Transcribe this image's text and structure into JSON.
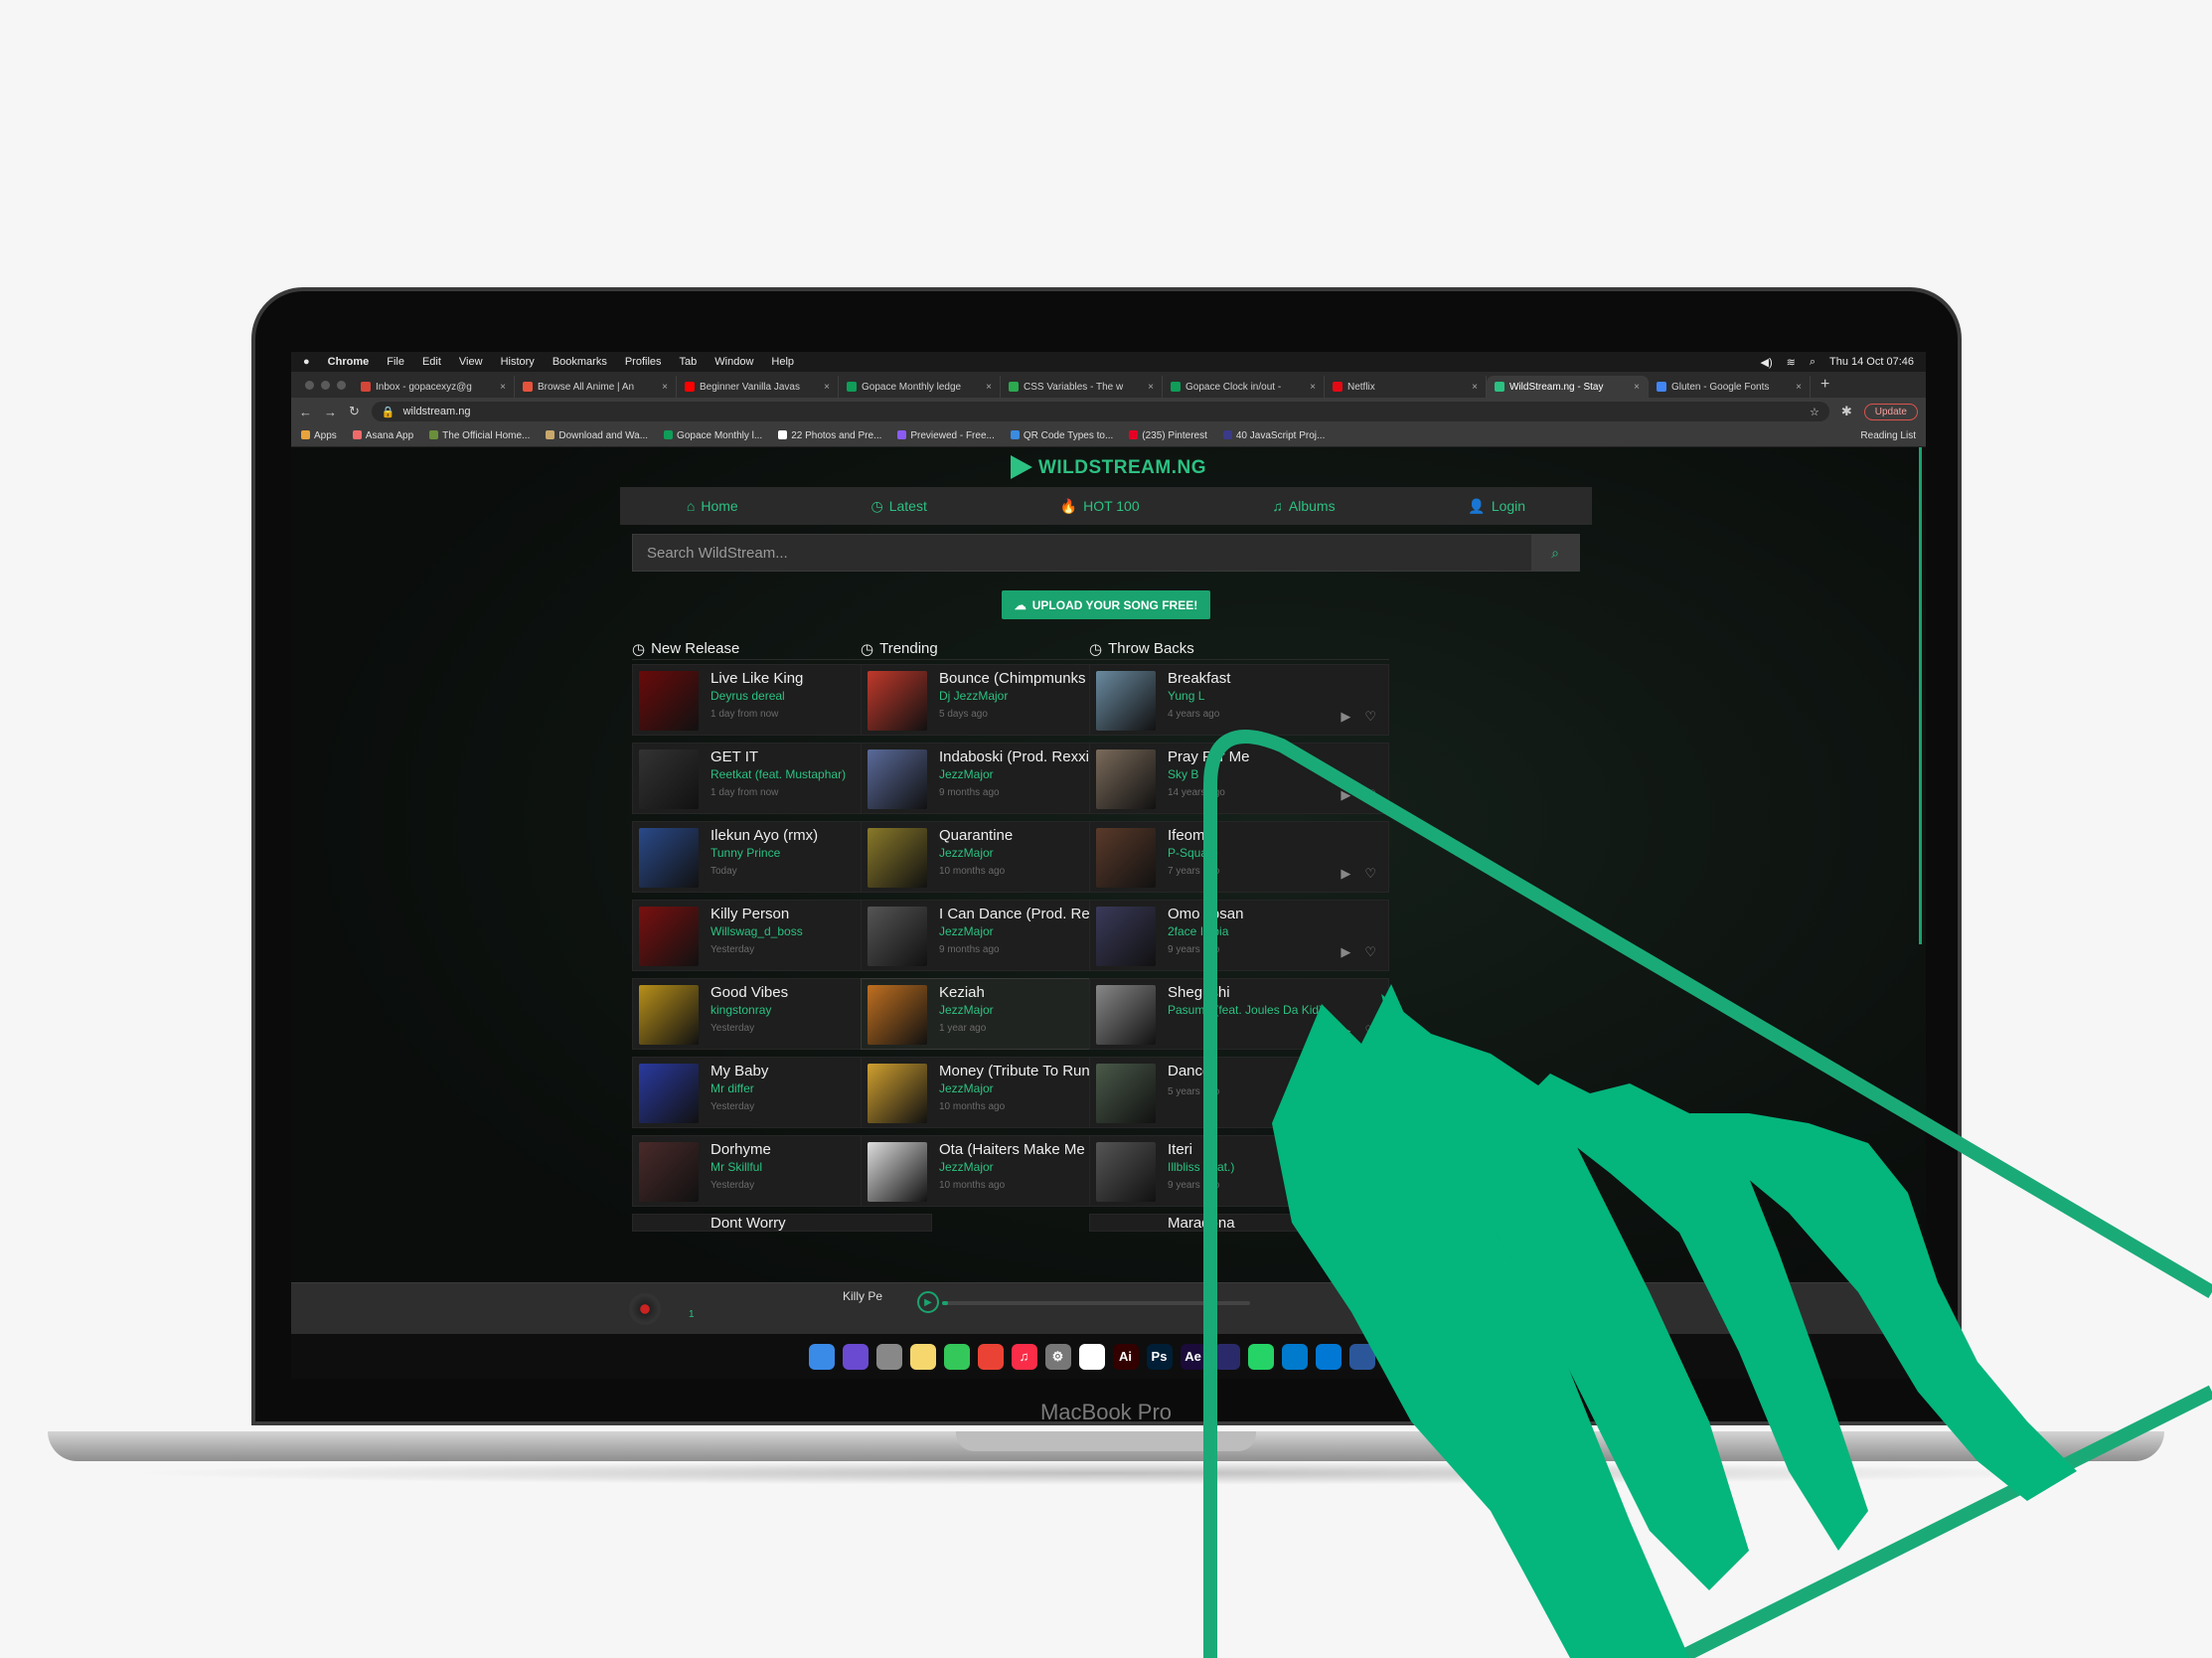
{
  "device": {
    "label": "MacBook Pro"
  },
  "menubar": {
    "app": "Chrome",
    "items": [
      "File",
      "Edit",
      "View",
      "History",
      "Bookmarks",
      "Profiles",
      "Tab",
      "Window",
      "Help"
    ],
    "datetime": "Thu 14 Oct  07:46"
  },
  "tabs": [
    {
      "title": "Inbox - gopacexyz@g",
      "color": "#d44638"
    },
    {
      "title": "Browse All Anime | An",
      "color": "#e5533c"
    },
    {
      "title": "Beginner Vanilla Javas",
      "color": "#ff0000"
    },
    {
      "title": "Gopace Monthly ledge",
      "color": "#0f9d58"
    },
    {
      "title": "CSS Variables - The w",
      "color": "#2ba94f"
    },
    {
      "title": "Gopace Clock in/out -",
      "color": "#0f9d58"
    },
    {
      "title": "Netflix",
      "color": "#e50914"
    },
    {
      "title": "WildStream.ng - Stay",
      "color": "#2cc182",
      "active": true
    },
    {
      "title": "Gluten - Google Fonts",
      "color": "#4285f4"
    }
  ],
  "address": {
    "url": "wildstream.ng",
    "update_label": "Update"
  },
  "bookmarks": [
    {
      "label": "Apps",
      "color": "#e8a33d"
    },
    {
      "label": "Asana App",
      "color": "#f06a6a"
    },
    {
      "label": "The Official Home...",
      "color": "#6a8f3a"
    },
    {
      "label": "Download and Wa...",
      "color": "#c9a86b"
    },
    {
      "label": "Gopace Monthly l...",
      "color": "#0f9d58"
    },
    {
      "label": "22 Photos and Pre...",
      "color": "#ffffff"
    },
    {
      "label": "Previewed - Free...",
      "color": "#8a5cf5"
    },
    {
      "label": "QR Code Types to...",
      "color": "#3b8be0"
    },
    {
      "label": "(235) Pinterest",
      "color": "#e60023"
    },
    {
      "label": "40 JavaScript Proj...",
      "color": "#3a3a8a"
    }
  ],
  "bookmarks_reading_list": "Reading List",
  "site": {
    "logo": "WILDSTREAM.NG",
    "nav": [
      {
        "label": "Home",
        "icon": "home-icon",
        "glyph": "⌂"
      },
      {
        "label": "Latest",
        "icon": "clock-icon",
        "glyph": "◷"
      },
      {
        "label": "HOT 100",
        "icon": "fire-icon",
        "glyph": "🔥"
      },
      {
        "label": "Albums",
        "icon": "headphones-icon",
        "glyph": "♫"
      },
      {
        "label": "Login",
        "icon": "user-icon",
        "glyph": "👤"
      }
    ],
    "search_placeholder": "Search WildStream...",
    "upload_label": "UPLOAD YOUR SONG FREE!",
    "columns": [
      {
        "title": "New Release",
        "icon": "clock-icon",
        "songs": [
          {
            "title": "Live Like King",
            "artist": "Deyrus dereal",
            "date": "1 day from now",
            "color": "#6a0a0a"
          },
          {
            "title": "GET IT",
            "artist": "Reetkat (feat. Mustaphar)",
            "date": "1 day from now",
            "color": "#333"
          },
          {
            "title": "Ilekun Ayo (rmx)",
            "artist": "Tunny Prince",
            "date": "Today",
            "color": "#2a4a8a"
          },
          {
            "title": "Killy Person",
            "artist": "Willswag_d_boss",
            "date": "Yesterday",
            "color": "#7a1010"
          },
          {
            "title": "Good Vibes",
            "artist": "kingstonray",
            "date": "Yesterday",
            "color": "#b8901a"
          },
          {
            "title": "My Baby",
            "artist": "Mr differ",
            "date": "Yesterday",
            "color": "#2a3aa0"
          },
          {
            "title": "Dorhyme",
            "artist": "Mr Skillful",
            "date": "Yesterday",
            "color": "#4a2a2a"
          }
        ],
        "partial": "Dont Worry"
      },
      {
        "title": "Trending",
        "icon": "chart-icon",
        "songs": [
          {
            "title": "Bounce (Chimpmunks Remix)",
            "artist": "Dj JezzMajor",
            "date": "5 days ago",
            "color": "#c0392b"
          },
          {
            "title": "Indaboski (Prod. Rexxie)",
            "artist": "JezzMajor",
            "date": "9 months ago",
            "color": "#5a6a9a"
          },
          {
            "title": "Quarantine",
            "artist": "JezzMajor",
            "date": "10 months ago",
            "color": "#8a7a2a"
          },
          {
            "title": "I Can Dance (Prod. Rexxie)",
            "artist": "JezzMajor",
            "date": "9 months ago",
            "color": "#555"
          },
          {
            "title": "Keziah",
            "artist": "JezzMajor",
            "date": "1 year ago",
            "color": "#c07020",
            "selected": true
          },
          {
            "title": "Money (Tribute To Runs Girls)",
            "artist": "JezzMajor",
            "date": "10 months ago",
            "color": "#d0a030"
          },
          {
            "title": "Ota (Haiters Make Me Famous)",
            "artist": "JezzMajor",
            "date": "10 months ago",
            "color": "#ddd"
          }
        ],
        "partial": ""
      },
      {
        "title": "Throw Backs",
        "icon": "history-icon",
        "songs": [
          {
            "title": "Breakfast",
            "artist": "Yung L",
            "date": "4 years ago",
            "color": "#6a8aa0"
          },
          {
            "title": "Pray For Me",
            "artist": "Sky B",
            "date": "14 years ago",
            "color": "#7a6a5a"
          },
          {
            "title": "Ifeoma",
            "artist": "P-Square",
            "date": "7 years ago",
            "color": "#5a3a2a"
          },
          {
            "title": "Omo Tosan",
            "artist": "2face Idibia",
            "date": "9 years ago",
            "color": "#3a3a5a"
          },
          {
            "title": "Shegushi",
            "artist": "Pasuma (feat. Joules Da Kid)",
            "date": "",
            "color": "#888"
          },
          {
            "title": "Dance",
            "artist": "",
            "date": "5 years ago",
            "color": "#4a5a4a"
          },
          {
            "title": "Iteri",
            "artist": "Illbliss (feat.)",
            "date": "9 years ago",
            "color": "#555"
          }
        ],
        "partial": "Maradona"
      }
    ],
    "player": {
      "now_playing": "Killy Pe",
      "position": "1",
      "progress": 0.02
    }
  },
  "dock_icons": [
    {
      "name": "finder-icon",
      "color": "#3a8ae8",
      "glyph": ""
    },
    {
      "name": "siri-icon",
      "color": "#6a4ad0",
      "glyph": ""
    },
    {
      "name": "launchpad-icon",
      "color": "#888",
      "glyph": ""
    },
    {
      "name": "notes-icon",
      "color": "#f5d76e",
      "glyph": ""
    },
    {
      "name": "messages-icon",
      "color": "#34c759",
      "glyph": ""
    },
    {
      "name": "chrome-icon",
      "color": "#ea4335",
      "glyph": ""
    },
    {
      "name": "music-icon",
      "color": "#fa2d48",
      "glyph": "♫"
    },
    {
      "name": "settings-icon",
      "color": "#777",
      "glyph": "⚙"
    },
    {
      "name": "slack-icon",
      "color": "#ffffff",
      "glyph": ""
    },
    {
      "name": "illustrator-icon",
      "color": "#330000",
      "glyph": "Ai"
    },
    {
      "name": "photoshop-icon",
      "color": "#001e36",
      "glyph": "Ps"
    },
    {
      "name": "after-effects-icon",
      "color": "#1a0b3a",
      "glyph": "Ae"
    },
    {
      "name": "premiere-icon",
      "color": "#2a2a6a",
      "glyph": ""
    },
    {
      "name": "whatsapp-icon",
      "color": "#25d366",
      "glyph": ""
    },
    {
      "name": "vscode-icon",
      "color": "#007acc",
      "glyph": ""
    },
    {
      "name": "outlook-icon",
      "color": "#0078d4",
      "glyph": ""
    },
    {
      "name": "word-icon",
      "color": "#2b579a",
      "glyph": ""
    },
    {
      "name": "trash-icon",
      "color": "#999",
      "glyph": ""
    }
  ]
}
